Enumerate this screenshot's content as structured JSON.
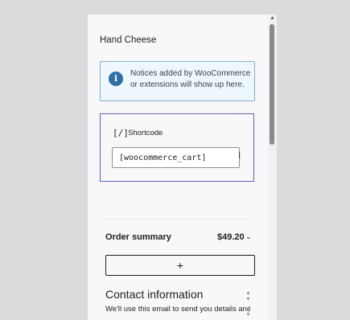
{
  "product": {
    "title": "Hand Cheese"
  },
  "notice": {
    "icon": "info-icon",
    "icon_glyph": "i",
    "text": "Notices added by WooCommerce or extensions will show up here."
  },
  "shortcode": {
    "icon": "[/]",
    "label": "Shortcode",
    "value": "[woocommerce_cart]"
  },
  "order_summary": {
    "label": "Order summary",
    "total": "$49.20"
  },
  "add_button": {
    "label": "+"
  },
  "contact": {
    "heading": "Contact information",
    "description": "We'll use this email to send you details and"
  },
  "colors": {
    "accent": "#5b64b5",
    "notice_border": "#7fb3c8",
    "notice_icon": "#2f6fa5"
  }
}
